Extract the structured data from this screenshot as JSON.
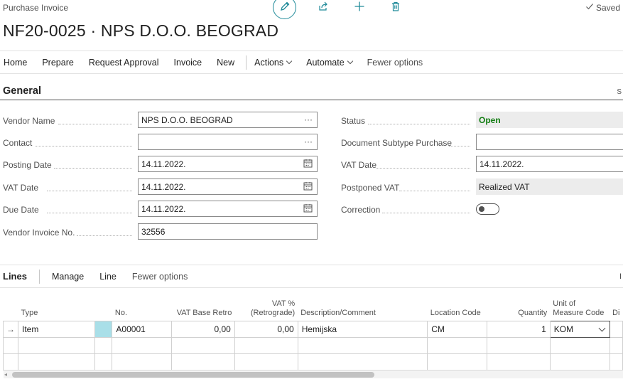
{
  "header": {
    "page_type": "Purchase Invoice",
    "title": "NF20-0025 · NPS D.O.O. BEOGRAD",
    "saved_label": "Saved",
    "icons": [
      "edit-icon",
      "share-icon",
      "add-icon",
      "delete-icon",
      "checkmark-icon"
    ]
  },
  "actions": {
    "home": "Home",
    "prepare": "Prepare",
    "request_approval": "Request Approval",
    "invoice": "Invoice",
    "new": "New",
    "actions": "Actions",
    "automate": "Automate",
    "fewer_options": "Fewer options"
  },
  "general": {
    "title": "General",
    "more": "S",
    "left": {
      "vendor_name": {
        "label": "Vendor Name",
        "value": "NPS D.O.O. BEOGRAD"
      },
      "contact": {
        "label": "Contact",
        "value": ""
      },
      "posting_date": {
        "label": "Posting Date",
        "value": "14.11.2022."
      },
      "vat_date": {
        "label": "VAT Date",
        "value": "14.11.2022."
      },
      "due_date": {
        "label": "Due Date",
        "value": "14.11.2022."
      },
      "vendor_invoice_no": {
        "label": "Vendor Invoice No.",
        "value": "32556"
      }
    },
    "right": {
      "status": {
        "label": "Status",
        "value": "Open"
      },
      "document_subtype": {
        "label": "Document Subtype Purchase",
        "value": ""
      },
      "vat_date": {
        "label": "VAT Date",
        "value": "14.11.2022."
      },
      "postponed_vat": {
        "label": "Postponed VAT",
        "value": "Realized VAT"
      },
      "correction": {
        "label": "Correction",
        "value": false
      }
    }
  },
  "lines": {
    "title": "Lines",
    "manage": "Manage",
    "line": "Line",
    "fewer_options": "Fewer options",
    "more": "I",
    "columns": {
      "type": "Type",
      "no": "No.",
      "vat_base_retro": "VAT Base Retro",
      "vat_pct_line1": "VAT %",
      "vat_pct_line2": "(Retrograde)",
      "description": "Description/Comment",
      "location_code": "Location Code",
      "quantity": "Quantity",
      "uom_line1": "Unit of",
      "uom_line2": "Measure Code",
      "di": "Di"
    },
    "rows": [
      {
        "marker": "→",
        "type": "Item",
        "no": "A00001",
        "vat_base_retro": "0,00",
        "vat_pct_retro": "0,00",
        "description": "Hemijska",
        "location_code": "CM",
        "quantity": "1",
        "uom": "KOM"
      }
    ]
  }
}
